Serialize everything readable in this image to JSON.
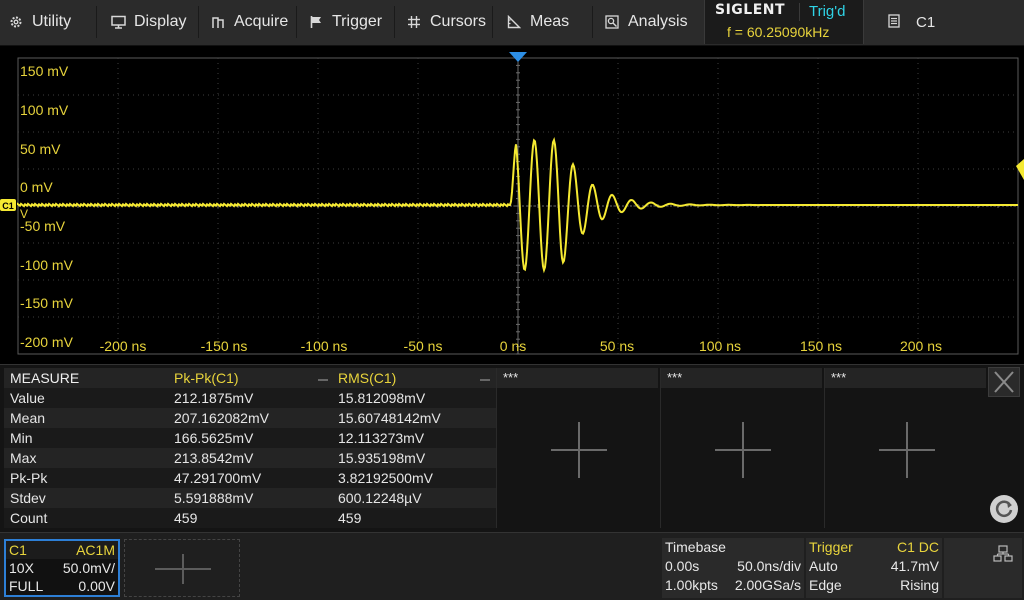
{
  "menu": [
    {
      "label": "Utility",
      "icon": "gear-icon"
    },
    {
      "label": "Display",
      "icon": "monitor-icon"
    },
    {
      "label": "Acquire",
      "icon": "acquire-icon"
    },
    {
      "label": "Trigger",
      "icon": "flag-icon"
    },
    {
      "label": "Cursors",
      "icon": "cursor-grid-icon"
    },
    {
      "label": "Meas",
      "icon": "ruler-icon"
    },
    {
      "label": "Analysis",
      "icon": "analysis-icon"
    }
  ],
  "brand": "SIGLENT",
  "trigger_state": "Trig'd",
  "frequency": "f = 60.25090kHz",
  "channel_menu": {
    "label": "C1",
    "icon": "list-icon"
  },
  "grid": {
    "y_labels": [
      "150 mV",
      "100 mV",
      "50 mV",
      "0 mV",
      "-50 mV",
      "-100 mV",
      "-150 mV",
      "-200 mV"
    ],
    "x_labels": [
      "-200 ns",
      "-150 ns",
      "-100 ns",
      "-50 ns",
      "0 ns",
      "50 ns",
      "100 ns",
      "150 ns",
      "200 ns"
    ],
    "channel_marker": "C1",
    "marker_unit": "V",
    "trace_color": "#f5e932"
  },
  "measure": {
    "headers": [
      "MEASURE",
      "Pk-Pk(C1)",
      "RMS(C1)"
    ],
    "rows": [
      [
        "Value",
        "212.1875mV",
        "15.812098mV"
      ],
      [
        "Mean",
        "207.162082mV",
        "15.60748142mV"
      ],
      [
        "Min",
        "166.5625mV",
        "12.113273mV"
      ],
      [
        "Max",
        "213.8542mV",
        "15.935198mV"
      ],
      [
        "Pk-Pk",
        "47.291700mV",
        "3.82192500mV"
      ],
      [
        "Stdev",
        "5.591888mV",
        "600.12248µV"
      ],
      [
        "Count",
        "459",
        "459"
      ]
    ],
    "empty_slots": [
      "***",
      "***",
      "***"
    ]
  },
  "channel_box": {
    "name": "C1",
    "coupling": "AC1M",
    "probe": "10X",
    "scale": "50.0mV/",
    "bandwidth": "FULL",
    "offset": "0.00V"
  },
  "timebase": {
    "title": "Timebase",
    "delay": "0.00s",
    "scale": "50.0ns/div",
    "memory": "1.00kpts",
    "sample_rate": "2.00GSa/s"
  },
  "trigger": {
    "title": "Trigger",
    "source": "C1 DC",
    "mode": "Auto",
    "level": "41.7mV",
    "type": "Edge",
    "slope": "Rising"
  }
}
